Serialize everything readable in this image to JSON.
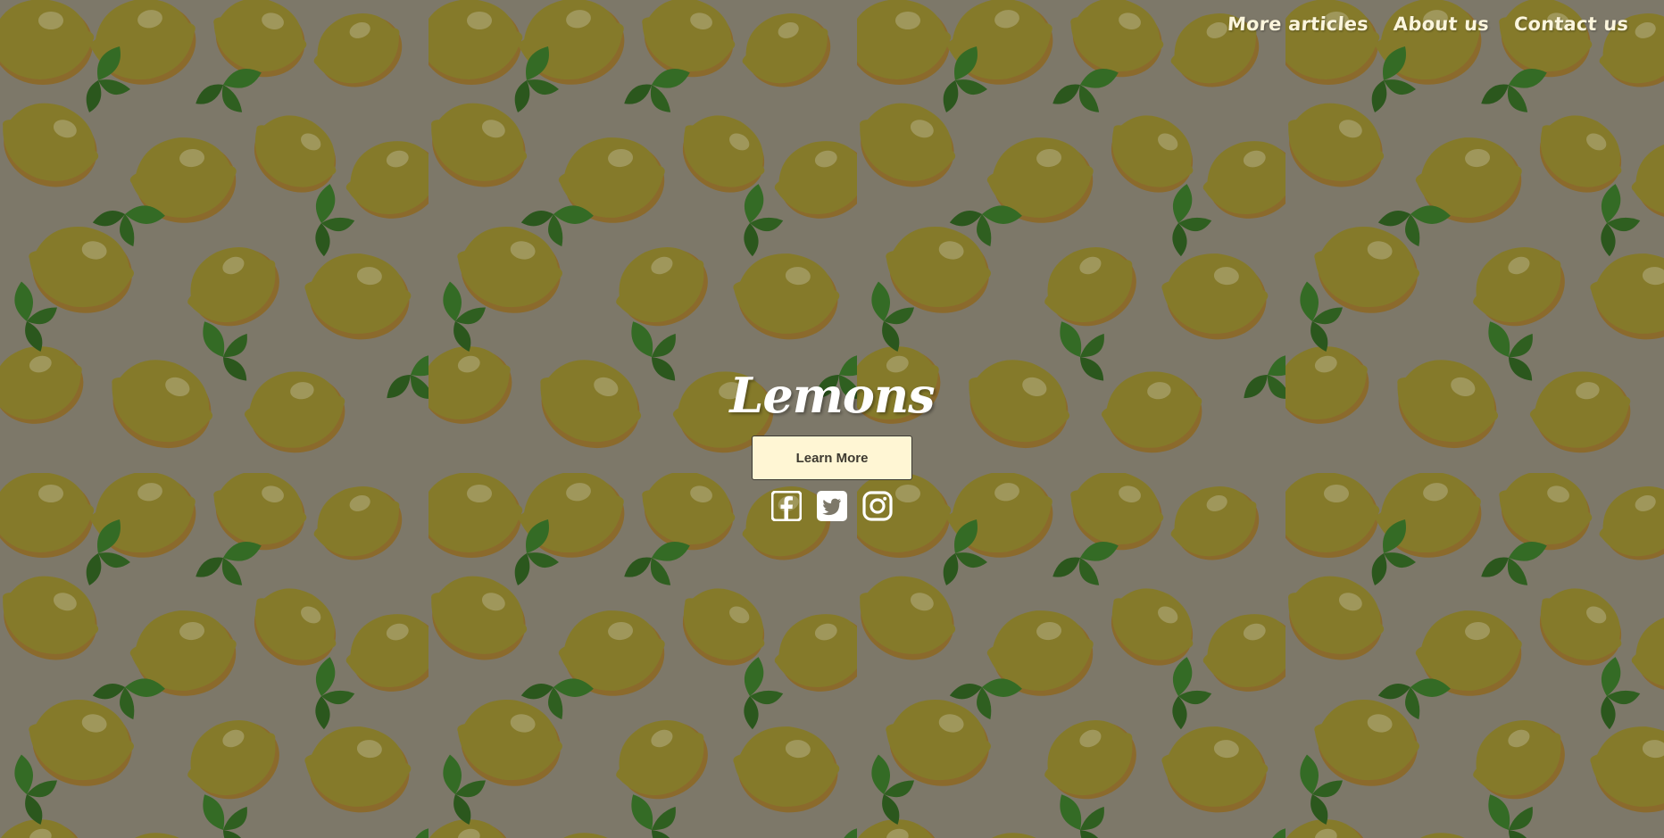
{
  "nav": {
    "items": [
      "More articles",
      "About us",
      "Contact us"
    ]
  },
  "hero": {
    "title": "Lemons",
    "cta_label": "Learn More"
  },
  "social": {
    "icons": [
      "facebook-icon",
      "twitter-icon",
      "instagram-icon"
    ]
  },
  "colors": {
    "background": "#7d7869",
    "lemon": "#857a2a",
    "lemon_rind": "#8e6a2c",
    "leaf": "#346b25",
    "button": "#fff6d4",
    "text": "#ffffff"
  }
}
